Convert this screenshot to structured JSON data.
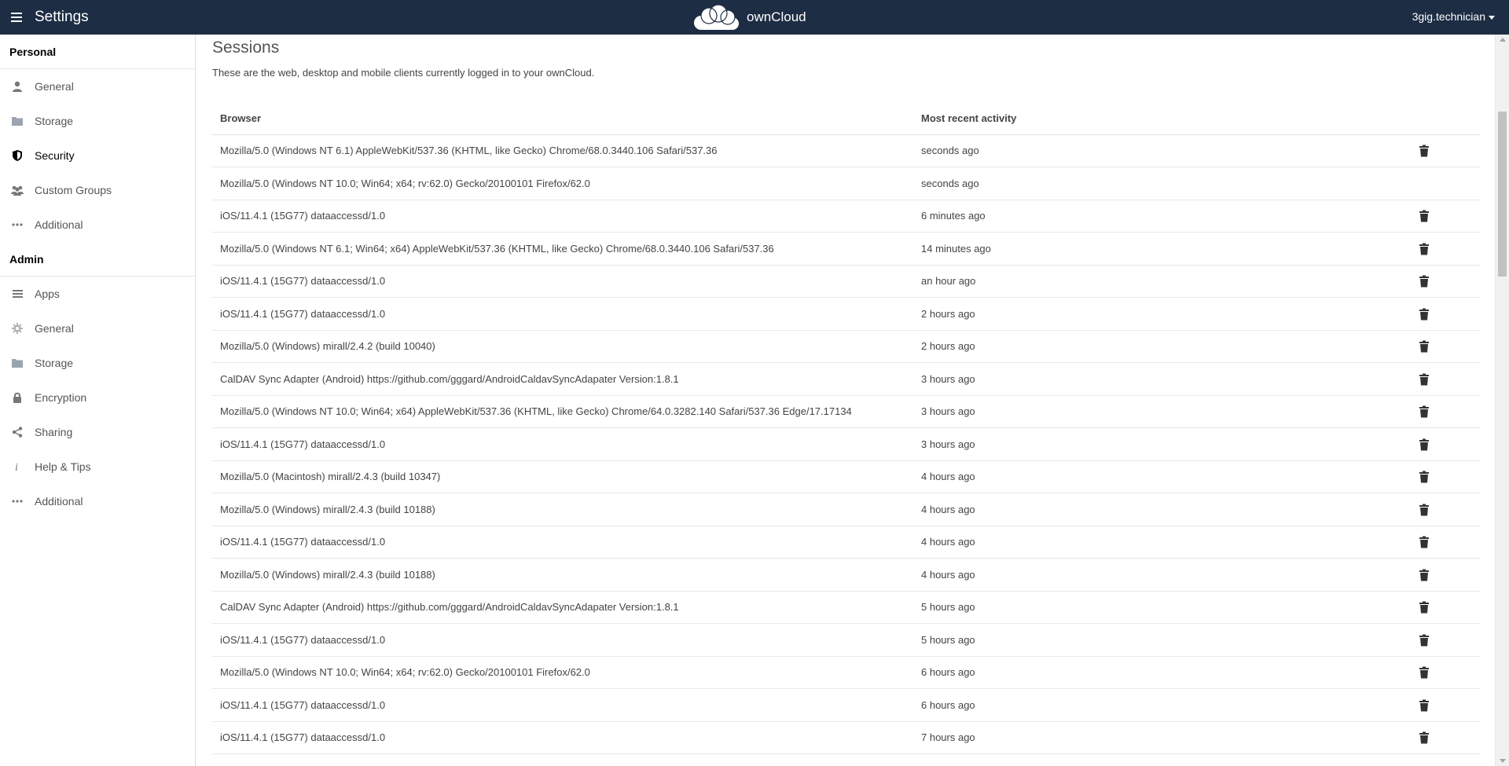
{
  "header": {
    "title": "Settings",
    "brand": "ownCloud",
    "user": "3gig.technician",
    "bg_color": "#1d2d44"
  },
  "sidebar": {
    "personal_title": "Personal",
    "personal_items": [
      {
        "label": "General",
        "icon": "user-icon"
      },
      {
        "label": "Storage",
        "icon": "folder-icon"
      },
      {
        "label": "Security",
        "icon": "shield-icon",
        "active": true
      },
      {
        "label": "Custom Groups",
        "icon": "group-icon"
      },
      {
        "label": "Additional",
        "icon": "more-icon"
      }
    ],
    "admin_title": "Admin",
    "admin_items": [
      {
        "label": "Apps",
        "icon": "list-icon"
      },
      {
        "label": "General",
        "icon": "gear-icon"
      },
      {
        "label": "Storage",
        "icon": "folder-icon"
      },
      {
        "label": "Encryption",
        "icon": "lock-icon"
      },
      {
        "label": "Sharing",
        "icon": "share-icon"
      },
      {
        "label": "Help & Tips",
        "icon": "info-icon"
      },
      {
        "label": "Additional",
        "icon": "more-icon"
      }
    ]
  },
  "main": {
    "title": "Sessions",
    "description": "These are the web, desktop and mobile clients currently logged in to your ownCloud.",
    "table": {
      "headers": {
        "browser": "Browser",
        "activity": "Most recent activity"
      },
      "rows": [
        {
          "browser": "Mozilla/5.0 (Windows NT 6.1) AppleWebKit/537.36 (KHTML, like Gecko) Chrome/68.0.3440.106 Safari/537.36",
          "activity": "seconds ago",
          "deletable": true
        },
        {
          "browser": "Mozilla/5.0 (Windows NT 10.0; Win64; x64; rv:62.0) Gecko/20100101 Firefox/62.0",
          "activity": "seconds ago",
          "deletable": false
        },
        {
          "browser": "iOS/11.4.1 (15G77) dataaccessd/1.0",
          "activity": "6 minutes ago",
          "deletable": true
        },
        {
          "browser": "Mozilla/5.0 (Windows NT 6.1; Win64; x64) AppleWebKit/537.36 (KHTML, like Gecko) Chrome/68.0.3440.106 Safari/537.36",
          "activity": "14 minutes ago",
          "deletable": true
        },
        {
          "browser": "iOS/11.4.1 (15G77) dataaccessd/1.0",
          "activity": "an hour ago",
          "deletable": true
        },
        {
          "browser": "iOS/11.4.1 (15G77) dataaccessd/1.0",
          "activity": "2 hours ago",
          "deletable": true
        },
        {
          "browser": "Mozilla/5.0 (Windows) mirall/2.4.2 (build 10040)",
          "activity": "2 hours ago",
          "deletable": true
        },
        {
          "browser": "CalDAV Sync Adapter (Android) https://github.com/gggard/AndroidCaldavSyncAdapater Version:1.8.1",
          "activity": "3 hours ago",
          "deletable": true
        },
        {
          "browser": "Mozilla/5.0 (Windows NT 10.0; Win64; x64) AppleWebKit/537.36 (KHTML, like Gecko) Chrome/64.0.3282.140 Safari/537.36 Edge/17.17134",
          "activity": "3 hours ago",
          "deletable": true
        },
        {
          "browser": "iOS/11.4.1 (15G77) dataaccessd/1.0",
          "activity": "3 hours ago",
          "deletable": true
        },
        {
          "browser": "Mozilla/5.0 (Macintosh) mirall/2.4.3 (build 10347)",
          "activity": "4 hours ago",
          "deletable": true
        },
        {
          "browser": "Mozilla/5.0 (Windows) mirall/2.4.3 (build 10188)",
          "activity": "4 hours ago",
          "deletable": true
        },
        {
          "browser": "iOS/11.4.1 (15G77) dataaccessd/1.0",
          "activity": "4 hours ago",
          "deletable": true
        },
        {
          "browser": "Mozilla/5.0 (Windows) mirall/2.4.3 (build 10188)",
          "activity": "4 hours ago",
          "deletable": true
        },
        {
          "browser": "CalDAV Sync Adapter (Android) https://github.com/gggard/AndroidCaldavSyncAdapater Version:1.8.1",
          "activity": "5 hours ago",
          "deletable": true
        },
        {
          "browser": "iOS/11.4.1 (15G77) dataaccessd/1.0",
          "activity": "5 hours ago",
          "deletable": true
        },
        {
          "browser": "Mozilla/5.0 (Windows NT 10.0; Win64; x64; rv:62.0) Gecko/20100101 Firefox/62.0",
          "activity": "6 hours ago",
          "deletable": true
        },
        {
          "browser": "iOS/11.4.1 (15G77) dataaccessd/1.0",
          "activity": "6 hours ago",
          "deletable": true
        },
        {
          "browser": "iOS/11.4.1 (15G77) dataaccessd/1.0",
          "activity": "7 hours ago",
          "deletable": true
        }
      ]
    }
  }
}
